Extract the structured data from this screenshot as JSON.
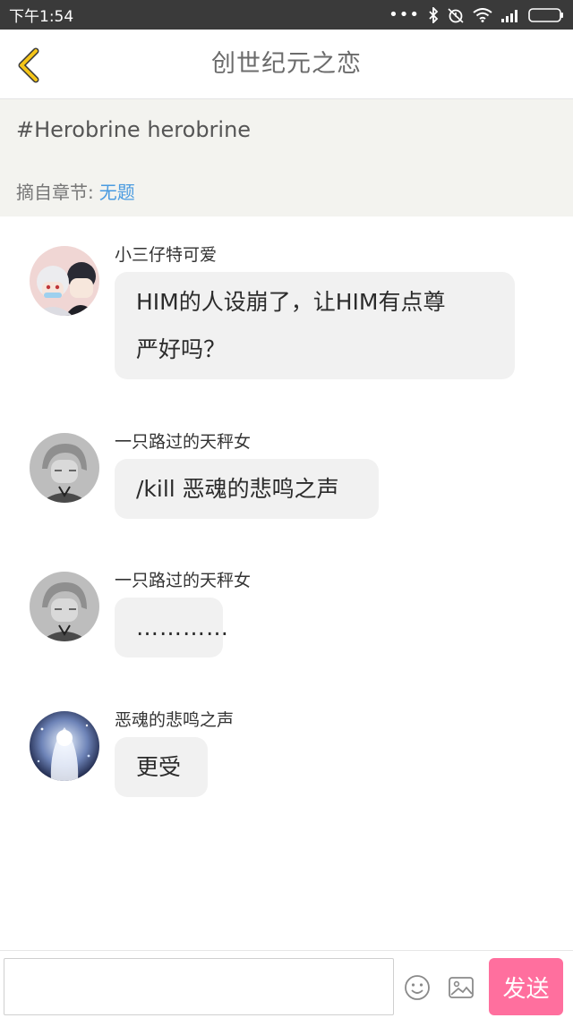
{
  "status_bar": {
    "time": "下午1:54",
    "dots": "•••",
    "icons": [
      "bluetooth-icon",
      "alarm-icon",
      "wifi-icon",
      "signal-icon",
      "battery-icon"
    ]
  },
  "header": {
    "title": "创世纪元之恋",
    "back_icon": "chevron-left-icon",
    "accent_color": "#f5c518"
  },
  "topic": {
    "tag": "#Herobrine herobrine",
    "chapter_label": "摘自章节:",
    "chapter_link": "无题",
    "link_color": "#4a9be0"
  },
  "messages": [
    {
      "sender": "小三仔特可爱",
      "lines": [
        "HIM的人设崩了，让HIM有点尊",
        "严好吗？"
      ],
      "avatar": "anime-couple-avatar"
    },
    {
      "sender": "一只路过的天秤女",
      "lines": [
        "/kill 恶魂的悲鸣之声"
      ],
      "avatar": "grey-anime-avatar"
    },
    {
      "sender": "一只路过的天秤女",
      "lines": [
        "…………"
      ],
      "avatar": "grey-anime-avatar"
    },
    {
      "sender": "恶魂的悲鸣之声",
      "lines": [
        "更受"
      ],
      "avatar": "ghost-girl-avatar"
    }
  ],
  "input_bar": {
    "text_value": "",
    "placeholder": "",
    "emoji_icon": "smiley-icon",
    "image_icon": "image-icon",
    "send_label": "发送",
    "send_color": "#ff6f9e"
  }
}
